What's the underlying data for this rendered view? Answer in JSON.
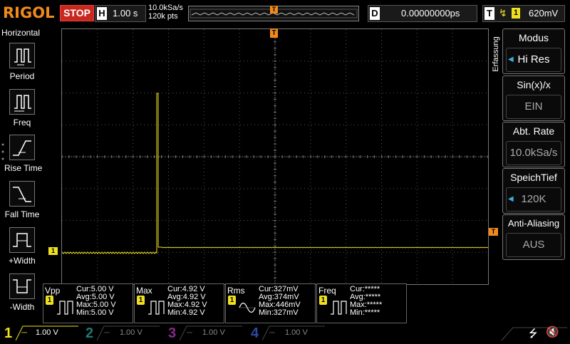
{
  "brand": "RIGOL",
  "run_state": "STOP",
  "horizontal": {
    "letter": "H",
    "timebase": "1.00 s",
    "sample_rate": "10.0kSa/s",
    "points": "120k pts"
  },
  "trigger_position_marker": "T",
  "delay": {
    "letter": "D",
    "value": "0.00000000ps"
  },
  "trigger": {
    "letter": "T",
    "channel": "1",
    "level": "620mV"
  },
  "left_menu": {
    "title": "Horizontal",
    "items": [
      {
        "label": "Period",
        "icon": "period-icon"
      },
      {
        "label": "Freq",
        "icon": "freq-icon"
      },
      {
        "label": "Rise Time",
        "icon": "rise-time-icon"
      },
      {
        "label": "Fall Time",
        "icon": "fall-time-icon"
      },
      {
        "label": "+Width",
        "icon": "plus-width-icon"
      },
      {
        "label": "-Width",
        "icon": "minus-width-icon"
      }
    ]
  },
  "right_menu": {
    "section_label": "Erfassung",
    "buttons": [
      {
        "title": "Modus",
        "value": "Hi Res"
      },
      {
        "title": "Sin(x)/x",
        "value": "EIN"
      },
      {
        "title": "Abt. Rate",
        "value": "10.0kSa/s"
      },
      {
        "title": "SpeichTief",
        "value": "120K"
      },
      {
        "title": "Anti-Aliasing",
        "value": "AUS"
      }
    ]
  },
  "channel_marker": "1",
  "trigger_level_marker": "T",
  "measurements": [
    {
      "name": "Vpp",
      "cur": "Cur:5.00 V",
      "avg": "Avg:5.00 V",
      "max": "Max:5.00 V",
      "min": "Min:5.00 V"
    },
    {
      "name": "Max",
      "cur": "Cur:4.92 V",
      "avg": "Avg:4.92 V",
      "max": "Max:4.92 V",
      "min": "Min:4.92 V"
    },
    {
      "name": "Rms",
      "cur": "Cur:327mV",
      "avg": "Avg:374mV",
      "max": "Max:446mV",
      "min": "Min:327mV"
    },
    {
      "name": "Freq",
      "cur": "Cur:*****",
      "avg": "Avg:*****",
      "max": "Max:*****",
      "min": "Min:*****"
    }
  ],
  "measurement_badge": "1",
  "channels": [
    {
      "num": "1",
      "scale": "1.00 V",
      "active": true,
      "color": "#f0e020"
    },
    {
      "num": "2",
      "scale": "1.00 V",
      "active": false,
      "color": "#1f7a72"
    },
    {
      "num": "3",
      "scale": "1.00 V",
      "active": false,
      "color": "#8a2a8a"
    },
    {
      "num": "4",
      "scale": "1.00 V",
      "active": false,
      "color": "#2a4aa0"
    }
  ],
  "colors": {
    "ch1": "#f0e020",
    "accent": "#f08a1c",
    "stop": "#c8281e"
  }
}
